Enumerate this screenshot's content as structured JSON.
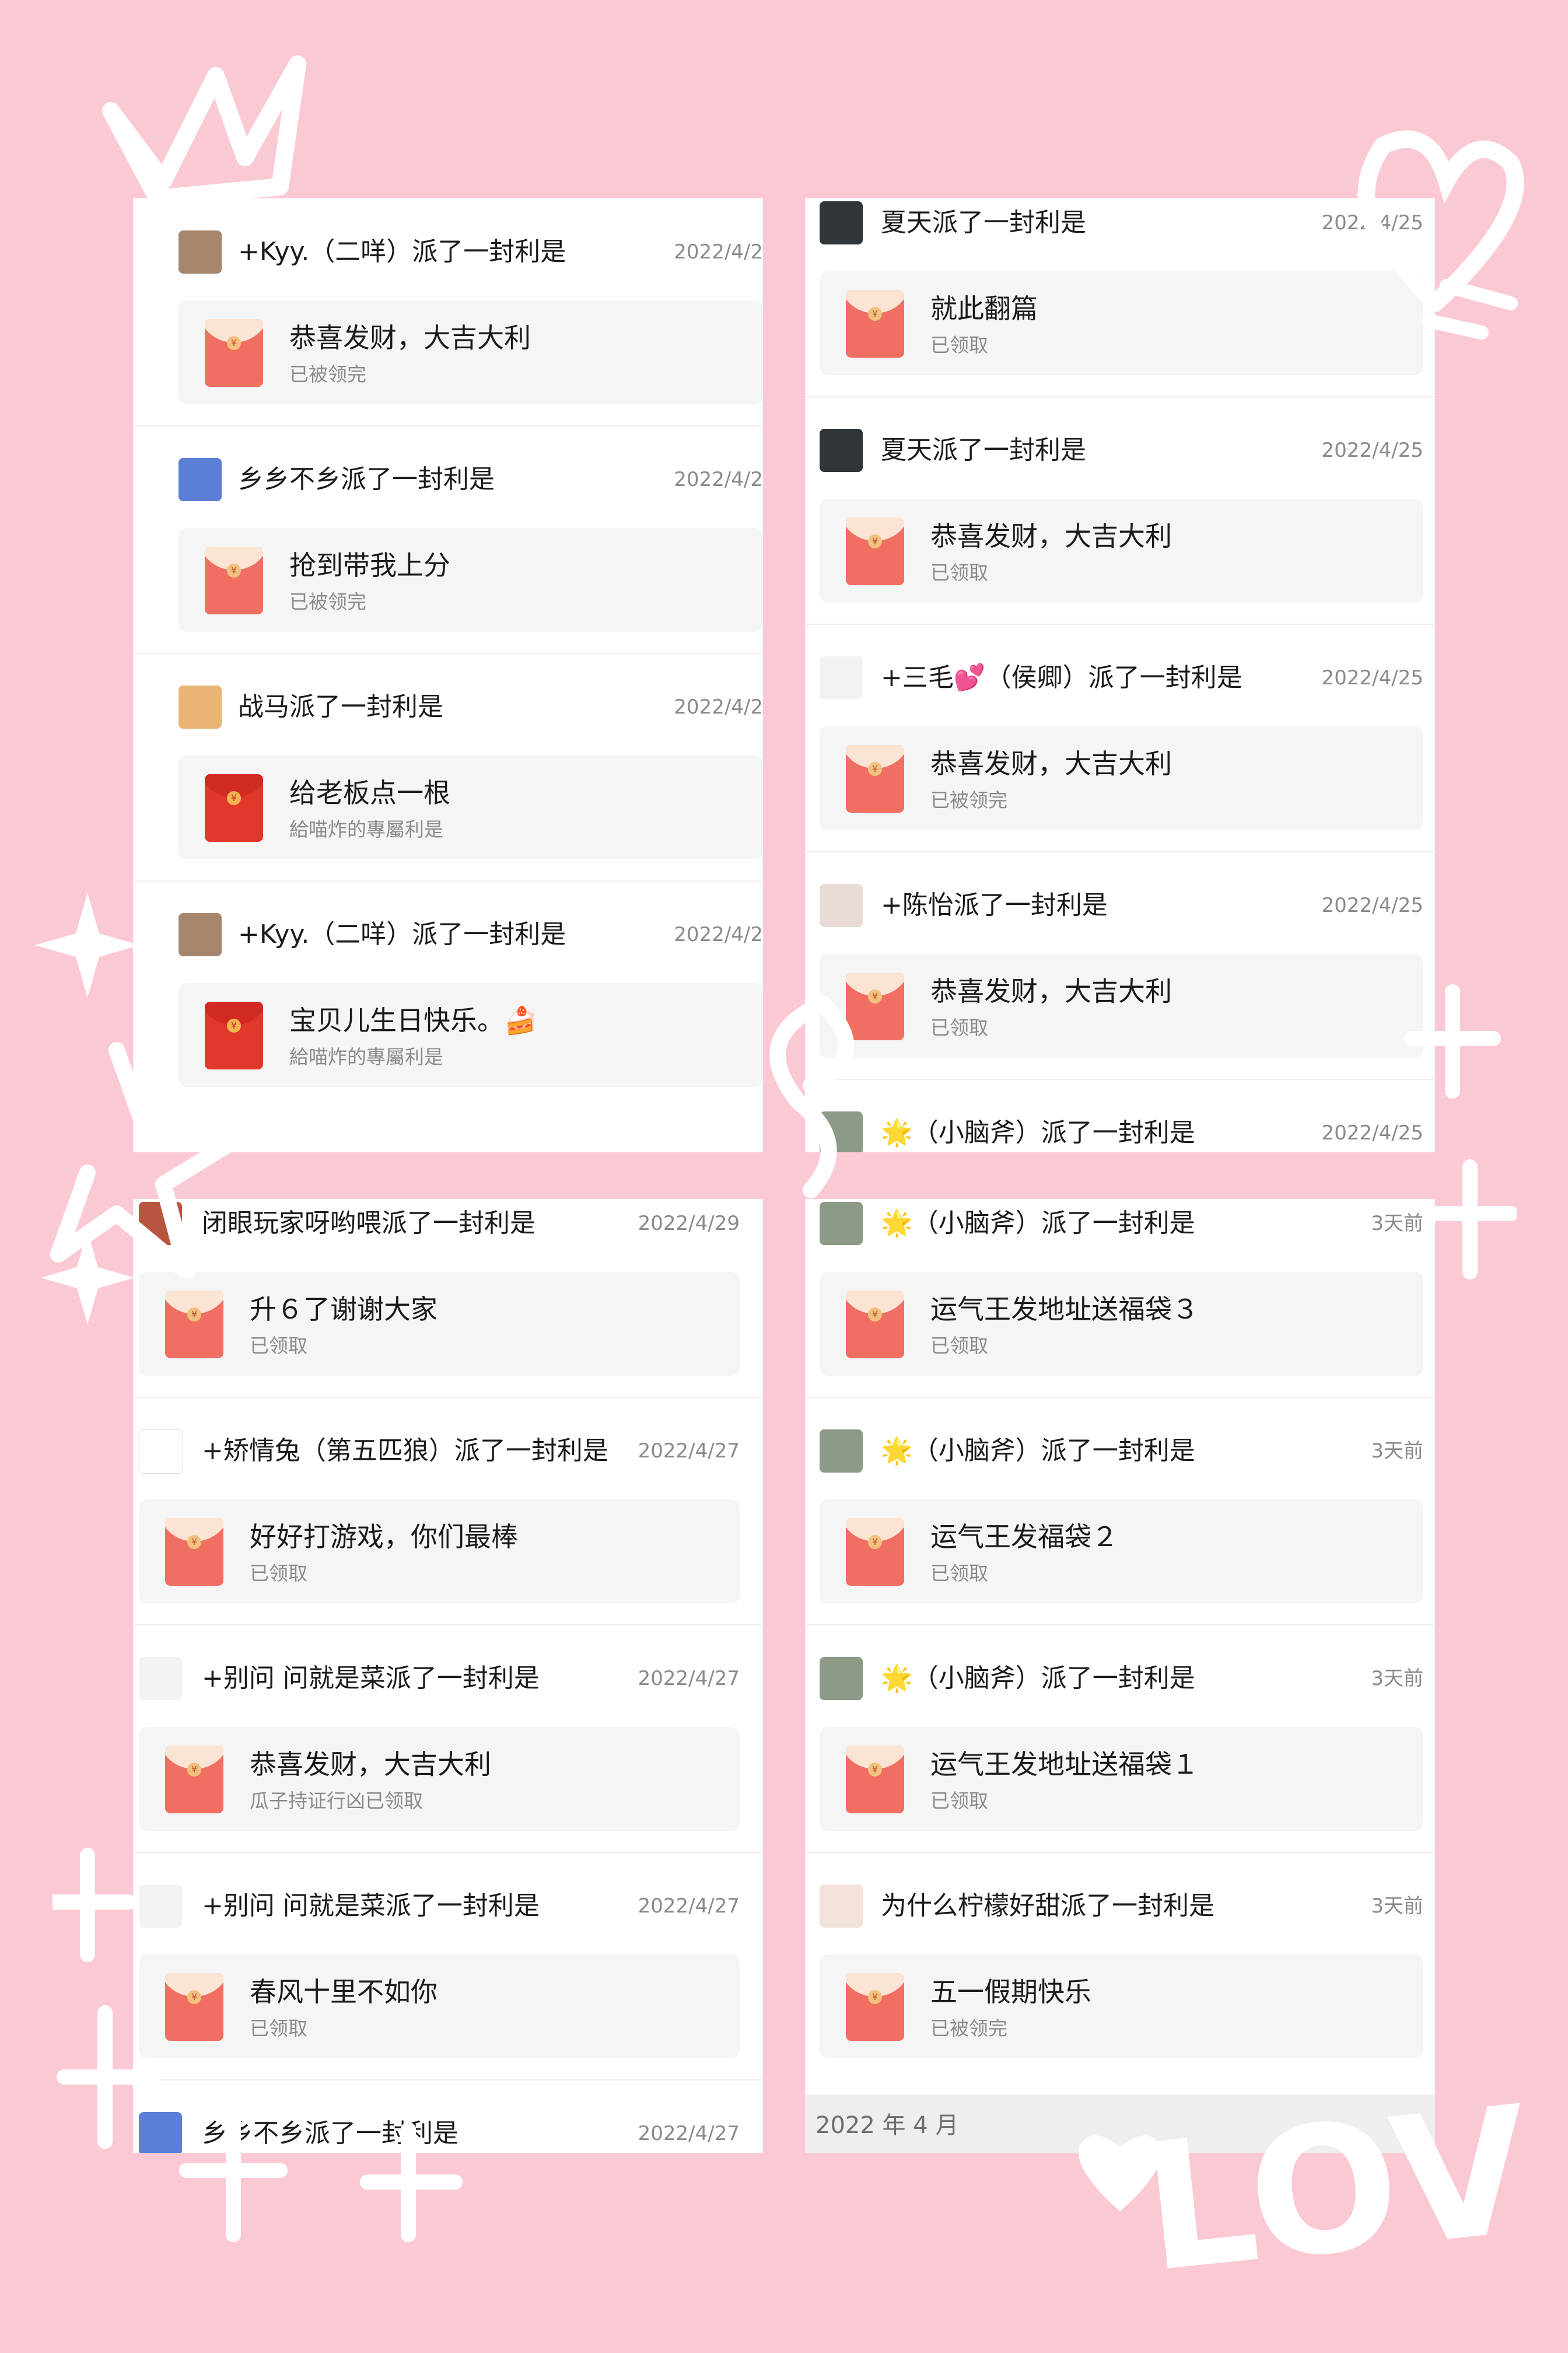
{
  "panels": [
    {
      "entries": [
        {
          "title": "+Kyy.（二咩）派了一封利是",
          "date": "2022/4/2",
          "card_title": "恭喜发财，大吉大利",
          "card_sub": "已被领完",
          "packet": "light",
          "avatar_color": "#a6876e"
        },
        {
          "title": "乡乡不乡派了一封利是",
          "date": "2022/4/2",
          "card_title": "抢到带我上分",
          "card_sub": "已被领完",
          "packet": "light",
          "avatar_color": "#5b7fd6"
        },
        {
          "title": "战马派了一封利是",
          "date": "2022/4/2",
          "card_title": "给老板点一根",
          "card_sub": "給喵炸的專屬利是",
          "packet": "dark",
          "avatar_color": "#e8b574"
        },
        {
          "title": "+Kyy.（二咩）派了一封利是",
          "date": "2022/4/2",
          "card_title": "宝贝儿生日快乐。🍰",
          "card_sub": "給喵炸的專屬利是",
          "packet": "dark",
          "avatar_color": "#a6876e"
        }
      ]
    },
    {
      "entries": [
        {
          "title": "夏天派了一封利是",
          "date": "2022/4/25",
          "card_title": "就此翻篇",
          "card_sub": "已领取",
          "packet": "light",
          "avatar_color": "#2f3538"
        },
        {
          "title": "夏天派了一封利是",
          "date": "2022/4/25",
          "card_title": "恭喜发财，大吉大利",
          "card_sub": "已领取",
          "packet": "light",
          "avatar_color": "#2f3538"
        },
        {
          "title": "+三毛💕（侯卿）派了一封利是",
          "date": "2022/4/25",
          "card_title": "恭喜发财，大吉大利",
          "card_sub": "已被领完",
          "packet": "light",
          "avatar_color": "#f2f2f2"
        },
        {
          "title": "+陈怡派了一封利是",
          "date": "2022/4/25",
          "card_title": "恭喜发财，大吉大利",
          "card_sub": "已领取",
          "packet": "light",
          "avatar_color": "#e9dcd6"
        },
        {
          "title": "🌟（小脑斧）派了一封利是",
          "date": "2022/4/25",
          "card_title": "",
          "card_sub": "",
          "packet": "light",
          "avatar_color": "#8c9a86"
        }
      ]
    },
    {
      "entries": [
        {
          "title": "闭眼玩家呀哟喂派了一封利是",
          "date": "2022/4/29",
          "card_title": "升６了谢谢大家",
          "card_sub": "已领取",
          "packet": "light",
          "avatar_color": "#b8553e"
        },
        {
          "title": "+矫情兔（第五匹狼）派了一封利是",
          "date": "2022/4/27",
          "card_title": "好好打游戏，你们最棒",
          "card_sub": "已领取",
          "packet": "light",
          "avatar_color": "#ffffff"
        },
        {
          "title": "+别问 问就是菜派了一封利是",
          "date": "2022/4/27",
          "card_title": "恭喜发财，大吉大利",
          "card_sub": "瓜子持证行凶已领取",
          "packet": "light",
          "avatar_color": "#f3f3f3"
        },
        {
          "title": "+别问 问就是菜派了一封利是",
          "date": "2022/4/27",
          "card_title": "春风十里不如你",
          "card_sub": "已领取",
          "packet": "light",
          "avatar_color": "#f3f3f3"
        },
        {
          "title": "乡乡不乡派了一封利是",
          "date": "2022/4/27",
          "card_title": "",
          "card_sub": "",
          "packet": "light",
          "avatar_color": "#5b7fd6"
        }
      ]
    },
    {
      "entries": [
        {
          "title": "🌟（小脑斧）派了一封利是",
          "date": "3天前",
          "card_title": "运气王发地址送福袋３",
          "card_sub": "已领取",
          "packet": "light",
          "avatar_color": "#8c9a86"
        },
        {
          "title": "🌟（小脑斧）派了一封利是",
          "date": "3天前",
          "card_title": "运气王发福袋２",
          "card_sub": "已领取",
          "packet": "light",
          "avatar_color": "#8c9a86"
        },
        {
          "title": "🌟（小脑斧）派了一封利是",
          "date": "3天前",
          "card_title": "运气王发地址送福袋１",
          "card_sub": "已领取",
          "packet": "light",
          "avatar_color": "#8c9a86"
        },
        {
          "title": "为什么柠檬好甜派了一封利是",
          "date": "3天前",
          "card_title": "五一假期快乐",
          "card_sub": "已被领完",
          "packet": "light",
          "avatar_color": "#f4e3da"
        }
      ],
      "month_label": "2022 年 4 月"
    }
  ],
  "decorations": {
    "love_text": "LOVE",
    "ink_color": "#ffffff"
  }
}
